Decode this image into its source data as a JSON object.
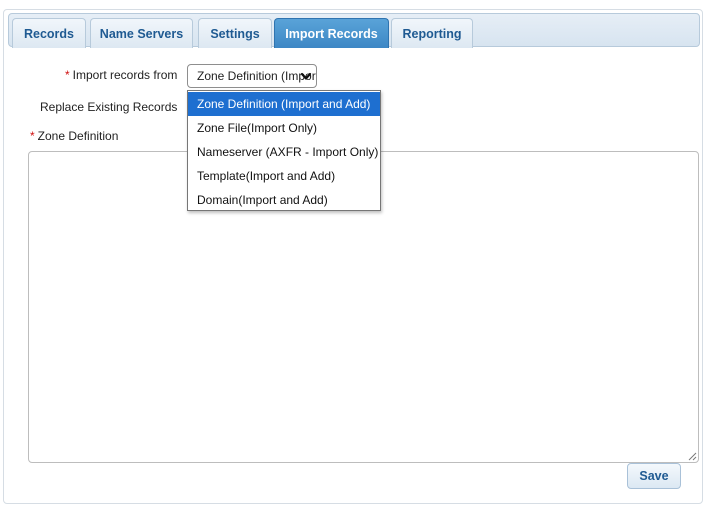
{
  "tabs": [
    {
      "label": "Records",
      "active": false
    },
    {
      "label": "Name Servers",
      "active": false
    },
    {
      "label": "Settings",
      "active": false
    },
    {
      "label": "Import Records",
      "active": true
    },
    {
      "label": "Reporting",
      "active": false
    }
  ],
  "form": {
    "required_marker": "*",
    "import_from_label": "Import records from",
    "import_from_value": "Zone Definition (Import and Add)",
    "replace_label": "Replace Existing Records",
    "zone_definition_label": "Zone Definition",
    "zone_definition_value": ""
  },
  "dropdown": {
    "options": [
      "Zone Definition (Import and Add)",
      "Zone File(Import Only)",
      "Nameserver (AXFR - Import Only)",
      "Template(Import and Add)",
      "Domain(Import and Add)"
    ],
    "selected_index": 0
  },
  "actions": {
    "save_label": "Save"
  },
  "icons": {
    "select_arrow": "chevron-down-icon",
    "resize_handle": "resize-grip-icon"
  },
  "colors": {
    "active_tab": "#3d87c5",
    "tab_text": "#1f5a92",
    "required": "#d01010",
    "option_highlight": "#1e6fd0"
  }
}
